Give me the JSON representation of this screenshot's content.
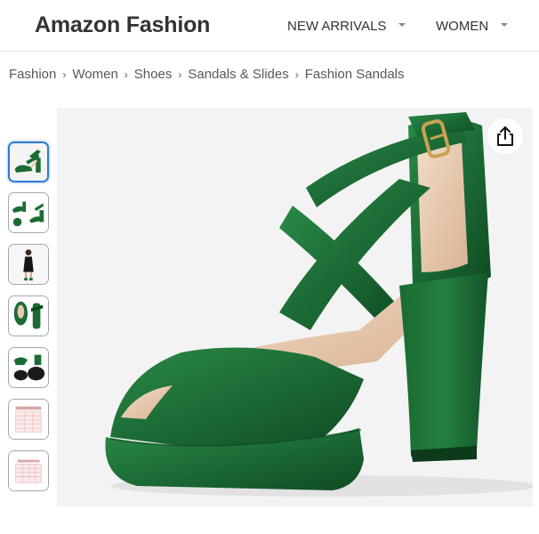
{
  "header": {
    "brand": "Amazon Fashion",
    "nav": [
      {
        "label": "NEW ARRIVALS",
        "icon": "chevron-down-icon"
      },
      {
        "label": "WOMEN",
        "icon": "chevron-down-icon"
      }
    ]
  },
  "breadcrumb": {
    "items": [
      "Fashion",
      "Women",
      "Shoes",
      "Sandals & Slides",
      "Fashion Sandals"
    ],
    "separator": "›"
  },
  "gallery": {
    "selected_index": 0,
    "thumbnails": [
      {
        "icon": "green-sandal-side-view"
      },
      {
        "icon": "green-sandal-pair-view"
      },
      {
        "icon": "model-wearing-black-dress"
      },
      {
        "icon": "green-sandal-back-view"
      },
      {
        "icon": "sandal-sole-view"
      },
      {
        "icon": "size-chart-table"
      },
      {
        "icon": "size-chart-table"
      }
    ],
    "share_icon": "share-icon"
  },
  "colors": {
    "velvet_green": "#1c6b35",
    "velvet_dark": "#0f4a22",
    "lining": "#e9c9ad",
    "selected_border": "#2f7bd4",
    "image_bg": "#f3f3f3"
  }
}
